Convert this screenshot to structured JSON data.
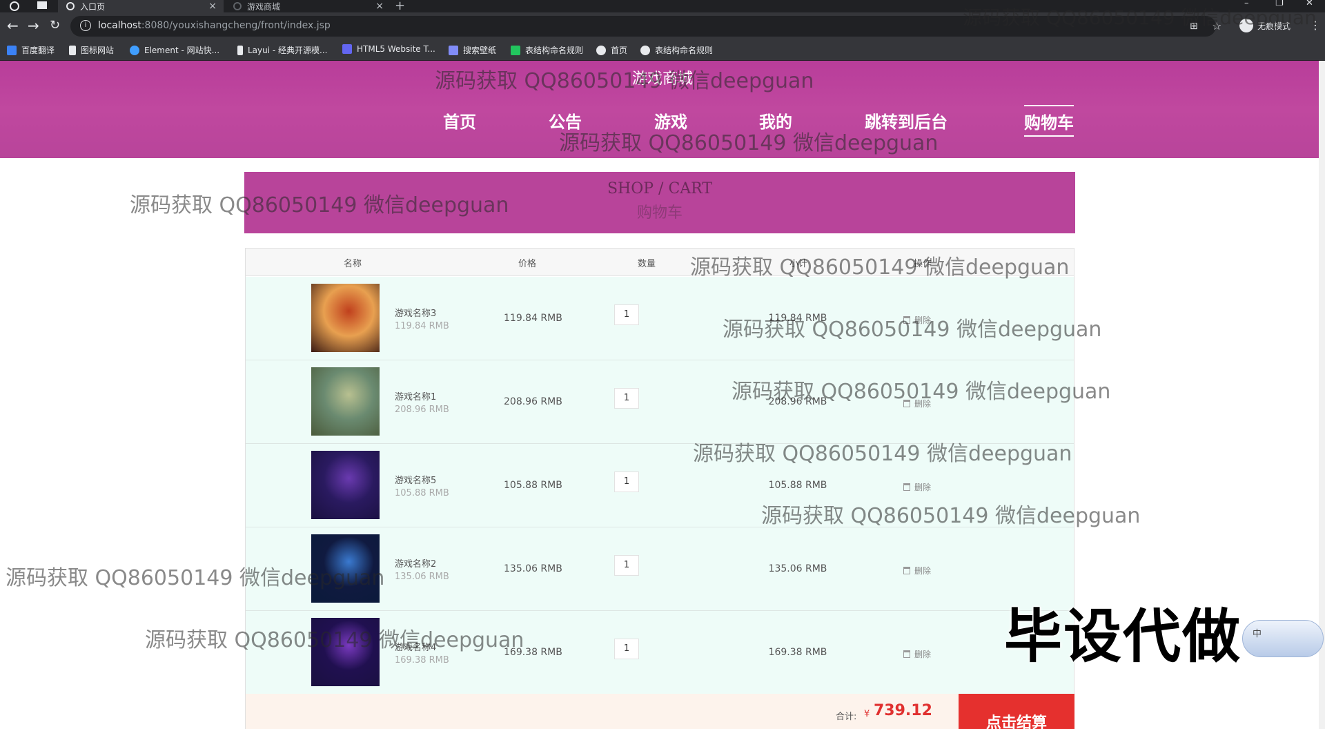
{
  "browser": {
    "tabs": [
      {
        "title": "入口页",
        "active": true
      },
      {
        "title": "游戏商城",
        "active": false
      }
    ],
    "url_host": "localhost",
    "url_path": ":8080/youxishangcheng/front/index.jsp",
    "incognito_label": "无痕模式",
    "bookmarks": [
      {
        "label": "百度翻译",
        "icon": "translate-icon",
        "color": "#3b82f6"
      },
      {
        "label": "图标网站",
        "icon": "flag-icon",
        "color": "#e8eaed"
      },
      {
        "label": "Element - 网站快...",
        "icon": "element-icon",
        "color": "#409eff"
      },
      {
        "label": "Layui - 经典开源模...",
        "icon": "layui-icon",
        "color": "#e8eaed"
      },
      {
        "label": "HTML5 Website T...",
        "icon": "html5-icon",
        "color": "#6366f1"
      },
      {
        "label": "搜索壁纸",
        "icon": "wallpaper-icon",
        "color": "#818cf8"
      },
      {
        "label": "表结构命名规则",
        "icon": "sheet-icon",
        "color": "#22c55e"
      },
      {
        "label": "首页",
        "icon": "globe-icon",
        "color": "#e8eaed"
      },
      {
        "label": "表结构命名规则",
        "icon": "globe-icon",
        "color": "#e8eaed"
      }
    ]
  },
  "site": {
    "title": "游戏商城",
    "nav": [
      "首页",
      "公告",
      "游戏",
      "我的",
      "跳转到后台",
      "购物车"
    ],
    "accent": "#b8449a"
  },
  "cart": {
    "banner_en": "SHOP / CART",
    "banner_zh": "购物车",
    "headers": {
      "name": "名称",
      "price": "价格",
      "qty": "数量",
      "subtotal": "小计",
      "action": "操作"
    },
    "items": [
      {
        "name": "游戏名称3",
        "unit": "119.84 RMB",
        "price": "119.84 RMB",
        "qty": "1",
        "subtotal": "119.84 RMB",
        "delete": "删除",
        "thumb": [
          "#3a1a12",
          "#c0401d",
          "#e8a050"
        ]
      },
      {
        "name": "游戏名称1",
        "unit": "208.96 RMB",
        "price": "208.96 RMB",
        "qty": "1",
        "subtotal": "208.96 RMB",
        "delete": "删除",
        "thumb": [
          "#4a5a3a",
          "#b8c090",
          "#6a8a70"
        ]
      },
      {
        "name": "游戏名称5",
        "unit": "105.88 RMB",
        "price": "105.88 RMB",
        "qty": "1",
        "subtotal": "105.88 RMB",
        "delete": "删除",
        "thumb": [
          "#1a1040",
          "#6a3ab0",
          "#2a1a60"
        ]
      },
      {
        "name": "游戏名称2",
        "unit": "135.06 RMB",
        "price": "135.06 RMB",
        "qty": "1",
        "subtotal": "135.06 RMB",
        "delete": "删除",
        "thumb": [
          "#0a1a3a",
          "#3a7ad0",
          "#101a40"
        ]
      },
      {
        "name": "游戏名称4",
        "unit": "169.38 RMB",
        "price": "169.38 RMB",
        "qty": "1",
        "subtotal": "169.38 RMB",
        "delete": "删除",
        "thumb": [
          "#1a1040",
          "#7a3ac0",
          "#201050"
        ]
      }
    ],
    "total_label": "合计:",
    "currency": "¥",
    "total": "739.12",
    "checkout": "点击结算",
    "checkout_color": "#e5302e"
  },
  "watermark": "源码获取 QQ86050149 微信deepguan",
  "overlay_text": "毕设代做",
  "ime_label": "中"
}
